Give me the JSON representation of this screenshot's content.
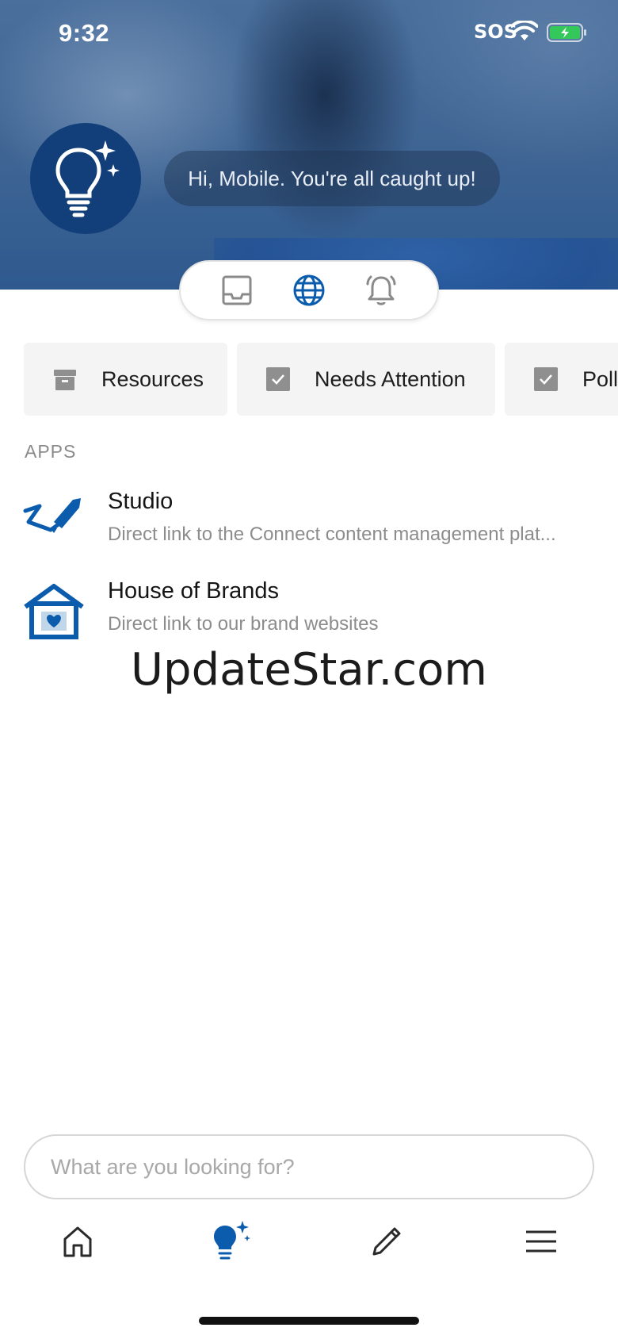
{
  "status_bar": {
    "time": "9:32",
    "sos": "SOS"
  },
  "header": {
    "greeting": "Hi, Mobile. You're all caught up!",
    "avatar_icon": "lightbulb-sparkle-icon",
    "modes": [
      {
        "icon": "inbox-tray-icon",
        "selected": false
      },
      {
        "icon": "globe-icon",
        "selected": true
      },
      {
        "icon": "bell-icon",
        "selected": false
      }
    ]
  },
  "chips": [
    {
      "label": "Resources",
      "icon": "archive-box-icon"
    },
    {
      "label": "Needs Attention",
      "icon": "checkbox-icon"
    },
    {
      "label": "Poll",
      "icon": "checkbox-icon"
    }
  ],
  "apps": {
    "section_label": "APPS",
    "items": [
      {
        "title": "Studio",
        "description": "Direct link to the Connect content management plat...",
        "icon": "studio-pen-icon"
      },
      {
        "title": "House of Brands",
        "description": "Direct link to our brand websites",
        "icon": "house-heart-icon"
      }
    ]
  },
  "watermark": "UpdateStar.com",
  "search": {
    "placeholder": "What are you looking for?",
    "value": ""
  },
  "tab_bar": [
    {
      "icon": "home-icon",
      "selected": false
    },
    {
      "icon": "lightbulb-sparkle-icon",
      "selected": true
    },
    {
      "icon": "pencil-icon",
      "selected": false
    },
    {
      "icon": "menu-icon",
      "selected": false
    }
  ],
  "colors": {
    "accent": "#0b5cad",
    "avatar_bg": "#123f7a",
    "chip_bg": "#f4f4f4",
    "battery_fill": "#34c759"
  }
}
